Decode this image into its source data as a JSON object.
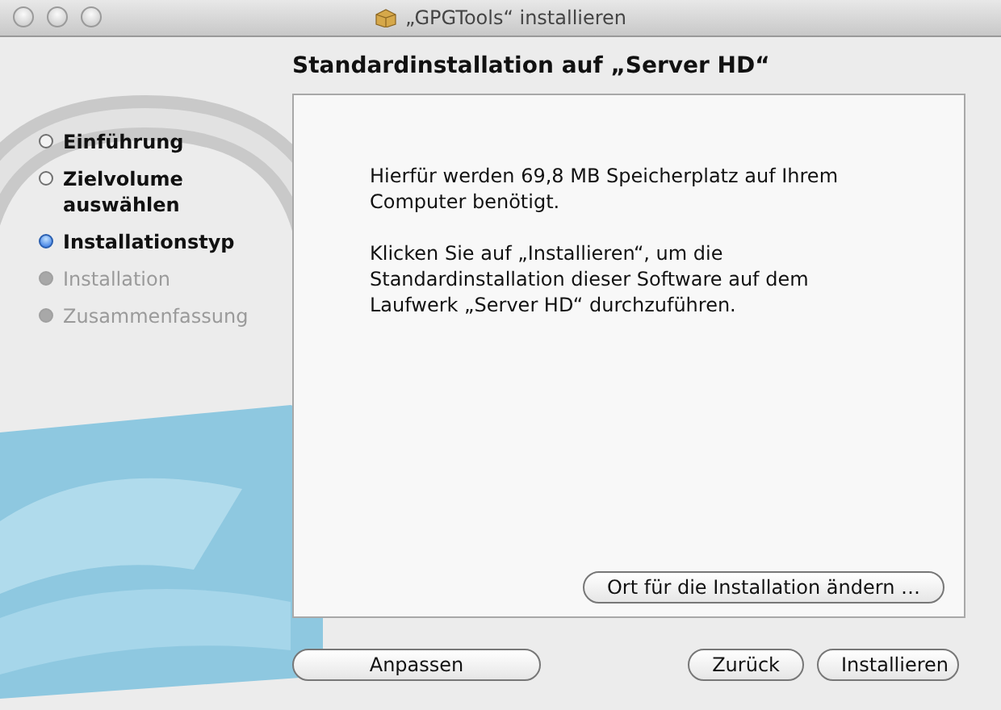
{
  "window": {
    "title": "„GPGTools“ installieren"
  },
  "heading": "Standardinstallation auf „Server HD“",
  "steps": [
    {
      "label": "Einführung",
      "selected": false,
      "completed": true
    },
    {
      "label": "Zielvolume auswählen",
      "selected": false,
      "completed": true
    },
    {
      "label": "Installationstyp",
      "selected": true,
      "completed": false
    },
    {
      "label": "Installation",
      "selected": false,
      "completed": false
    },
    {
      "label": "Zusammenfassung",
      "selected": false,
      "completed": false
    }
  ],
  "content": {
    "paragraphs": [
      "Hierfür werden 69,8 MB Speicherplatz auf Ihrem Computer benötigt.",
      "Klicken Sie auf „Installieren“, um die Standardinstallation dieser Software auf dem Laufwerk „Server HD“ durchzuführen."
    ],
    "location_button": "Ort für die Installation ändern …"
  },
  "buttons": {
    "left": "Anpassen",
    "back": "Zurück",
    "continue": "Installieren"
  }
}
